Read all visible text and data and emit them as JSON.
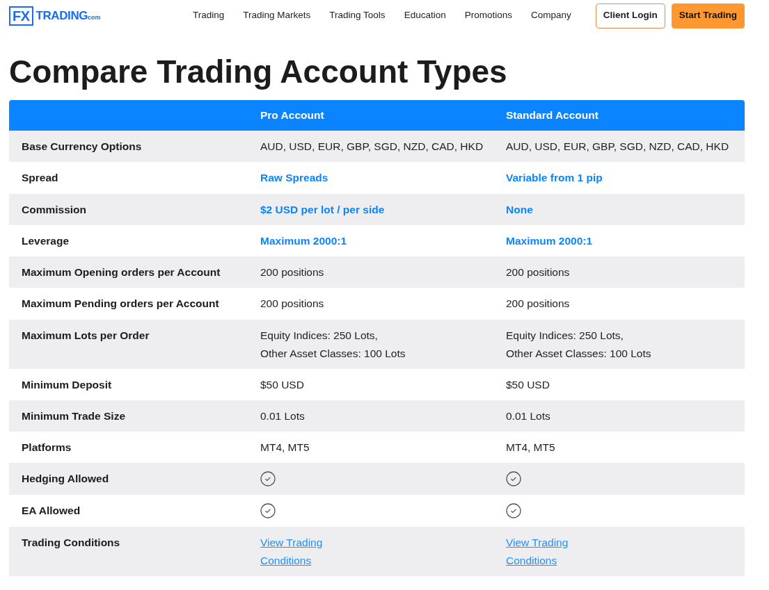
{
  "logo": {
    "mark": "FX",
    "name": "TRADING",
    "suffix": "com"
  },
  "nav": [
    "Trading",
    "Trading Markets",
    "Trading Tools",
    "Education",
    "Promotions",
    "Company"
  ],
  "buttons": [
    {
      "label": "Client Login",
      "kind": "outline"
    },
    {
      "label": "Start Trading",
      "kind": "primary"
    }
  ],
  "title": "Compare Trading Account Types",
  "table": {
    "columns": [
      "Pro Account",
      "Standard Account"
    ],
    "rows": [
      {
        "label": "Base Currency Options",
        "cells": [
          {
            "kind": "text",
            "lines": [
              "AUD, USD, EUR, GBP, SGD, NZD, CAD, HKD"
            ]
          },
          {
            "kind": "text",
            "lines": [
              "AUD, USD, EUR, GBP, SGD, NZD, CAD, HKD"
            ]
          }
        ]
      },
      {
        "label": "Spread",
        "cells": [
          {
            "kind": "highlight",
            "lines": [
              "Raw Spreads"
            ]
          },
          {
            "kind": "highlight",
            "lines": [
              "Variable from 1 pip"
            ]
          }
        ]
      },
      {
        "label": "Commission",
        "cells": [
          {
            "kind": "highlight",
            "lines": [
              "$2 USD per lot / per side"
            ]
          },
          {
            "kind": "highlight",
            "lines": [
              "None"
            ]
          }
        ]
      },
      {
        "label": "Leverage",
        "cells": [
          {
            "kind": "highlight",
            "lines": [
              "Maximum 2000:1"
            ]
          },
          {
            "kind": "highlight",
            "lines": [
              "Maximum 2000:1"
            ]
          }
        ]
      },
      {
        "label": "Maximum Opening orders per Account",
        "cells": [
          {
            "kind": "text",
            "lines": [
              "200 positions"
            ]
          },
          {
            "kind": "text",
            "lines": [
              "200 positions"
            ]
          }
        ]
      },
      {
        "label": "Maximum Pending orders per Account",
        "cells": [
          {
            "kind": "text",
            "lines": [
              "200 positions"
            ]
          },
          {
            "kind": "text",
            "lines": [
              "200 positions"
            ]
          }
        ]
      },
      {
        "label": "Maximum Lots per Order",
        "cells": [
          {
            "kind": "text",
            "lines": [
              "Equity Indices: 250 Lots,",
              "Other Asset Classes: 100 Lots"
            ]
          },
          {
            "kind": "text",
            "lines": [
              "Equity Indices: 250 Lots,",
              "Other Asset Classes: 100 Lots"
            ]
          }
        ]
      },
      {
        "label": "Minimum Deposit",
        "cells": [
          {
            "kind": "text",
            "lines": [
              "$50 USD"
            ]
          },
          {
            "kind": "text",
            "lines": [
              "$50 USD"
            ]
          }
        ]
      },
      {
        "label": "Minimum Trade Size",
        "cells": [
          {
            "kind": "text",
            "lines": [
              "0.01 Lots"
            ]
          },
          {
            "kind": "text",
            "lines": [
              "0.01 Lots"
            ]
          }
        ]
      },
      {
        "label": "Platforms",
        "cells": [
          {
            "kind": "text",
            "lines": [
              "MT4, MT5"
            ]
          },
          {
            "kind": "text",
            "lines": [
              "MT4, MT5"
            ]
          }
        ]
      },
      {
        "label": "Hedging Allowed",
        "cells": [
          {
            "kind": "check",
            "checked": true
          },
          {
            "kind": "check",
            "checked": true
          }
        ]
      },
      {
        "label": "EA Allowed",
        "cells": [
          {
            "kind": "check",
            "checked": true
          },
          {
            "kind": "check",
            "checked": true
          }
        ]
      },
      {
        "label": "Trading Conditions",
        "cells": [
          {
            "kind": "link",
            "lines": [
              "View Trading",
              "Conditions"
            ]
          },
          {
            "kind": "link",
            "lines": [
              "View Trading",
              "Conditions"
            ]
          }
        ]
      }
    ]
  }
}
